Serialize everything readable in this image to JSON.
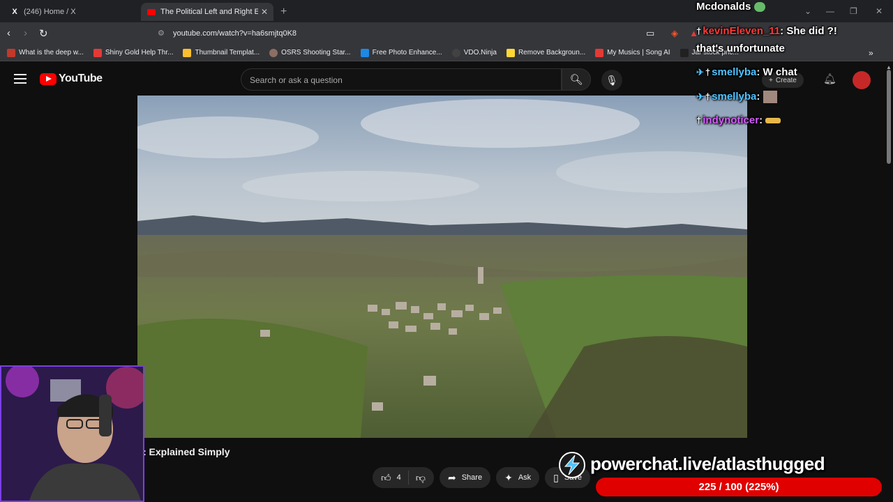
{
  "browser": {
    "tabs": [
      {
        "title": "(246) Home / X",
        "active": false
      },
      {
        "title": "The Political Left and Right Expla",
        "active": true
      }
    ],
    "url": "youtube.com/watch?v=ha6smjtq0K8",
    "bookmarks": [
      {
        "label": "What is the deep w...",
        "color": "#c0392b"
      },
      {
        "label": "Shiny Gold Help Thr...",
        "color": "#e53935"
      },
      {
        "label": "Thumbnail Templat...",
        "color": "#fbc02d"
      },
      {
        "label": "OSRS Shooting Star...",
        "color": "#8d6e63"
      },
      {
        "label": "Free Photo Enhance...",
        "color": "#1e88e5"
      },
      {
        "label": "VDO.Ninja",
        "color": "#424242"
      },
      {
        "label": "Remove Backgroun...",
        "color": "#fdd835"
      },
      {
        "label": "My Musics | Song AI",
        "color": "#e53935"
      },
      {
        "label": "Jar stock pric...",
        "color": "#212121"
      }
    ]
  },
  "youtube": {
    "logo_text": "YouTube",
    "search_placeholder": "Search or ask a question",
    "create_label": "Create",
    "video_title_partial": ": Explained Simply",
    "actions": {
      "like_count": "4",
      "share": "Share",
      "ask": "Ask",
      "save": "Save"
    }
  },
  "overlay": {
    "chat": [
      {
        "user": "Mcdonalds",
        "message": "",
        "color": "#ffffff"
      },
      {
        "user": "kevinEleven_11",
        "message": "She did ?!",
        "color": "#ff3b3b"
      },
      {
        "user": "",
        "message": "that's unfortunate",
        "color": "#ffffff"
      },
      {
        "user": "smellyba",
        "message": "W chat",
        "color": "#4fc3ff"
      },
      {
        "user": "smellyba",
        "message": "",
        "color": "#4fc3ff"
      },
      {
        "user": "indynoticer",
        "message": "",
        "color": "#d65cff"
      }
    ],
    "powerchat": {
      "url_text": "powerchat.live/atlasthugged",
      "goal_text": "225 / 100 (225%)",
      "goal_fraction": 2.25
    }
  }
}
